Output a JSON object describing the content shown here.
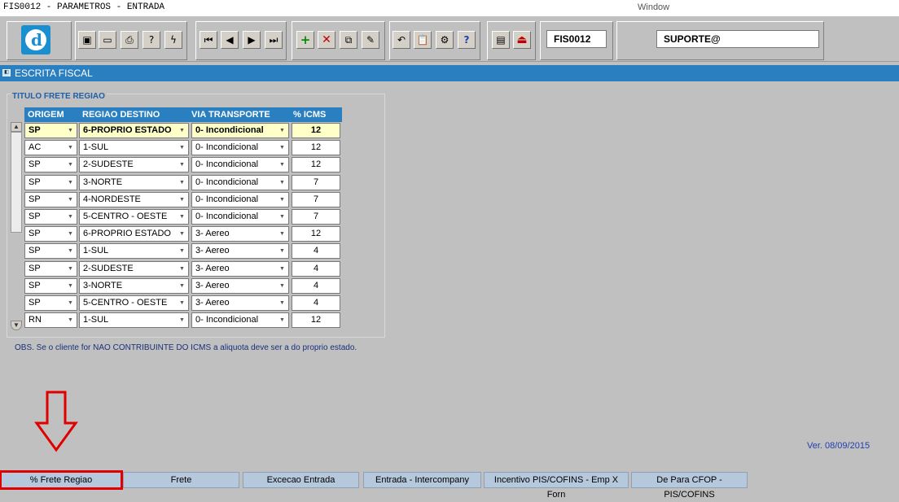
{
  "window": {
    "title": "FIS0012 - PARAMETROS - ENTRADA",
    "menu_label": "Window"
  },
  "toolbar": {
    "form_code": "FIS0012",
    "user": "SUPORTE@"
  },
  "section": {
    "title": "ESCRITA FISCAL"
  },
  "frame": {
    "title": "TITULO FRETE REGIAO"
  },
  "table": {
    "headers": [
      "ORIGEM",
      "REGIAO DESTINO",
      "VIA TRANSPORTE",
      "% ICMS"
    ],
    "rows": [
      [
        "SP",
        "6-PROPRIO ESTADO",
        "0- Incondicional",
        "12"
      ],
      [
        "AC",
        "1-SUL",
        "0- Incondicional",
        "12"
      ],
      [
        "SP",
        "2-SUDESTE",
        "0- Incondicional",
        "12"
      ],
      [
        "SP",
        "3-NORTE",
        "0- Incondicional",
        "7"
      ],
      [
        "SP",
        "4-NORDESTE",
        "0- Incondicional",
        "7"
      ],
      [
        "SP",
        "5-CENTRO - OESTE",
        "0- Incondicional",
        "7"
      ],
      [
        "SP",
        "6-PROPRIO ESTADO",
        "3- Aereo",
        "12"
      ],
      [
        "SP",
        "1-SUL",
        "3- Aereo",
        "4"
      ],
      [
        "SP",
        "2-SUDESTE",
        "3- Aereo",
        "4"
      ],
      [
        "SP",
        "3-NORTE",
        "3- Aereo",
        "4"
      ],
      [
        "SP",
        "5-CENTRO - OESTE",
        "3- Aereo",
        "4"
      ],
      [
        "RN",
        "1-SUL",
        "0- Incondicional",
        "12"
      ]
    ]
  },
  "obs": "OBS. Se o cliente for NAO CONTRIBUINTE DO ICMS a aliquota deve ser a do proprio estado.",
  "version": "Ver. 08/09/2015",
  "tabs": [
    "% Frete Regiao",
    "Frete",
    "Excecao Entrada",
    "Entrada - Intercompany",
    "Incentivo PIS/COFINS - Emp X Forn",
    "De Para CFOP - PIS/COFINS"
  ],
  "colors": {
    "accent": "#2a7fc1",
    "selected_row": "#ffffc8",
    "highlight": "#e00000"
  }
}
